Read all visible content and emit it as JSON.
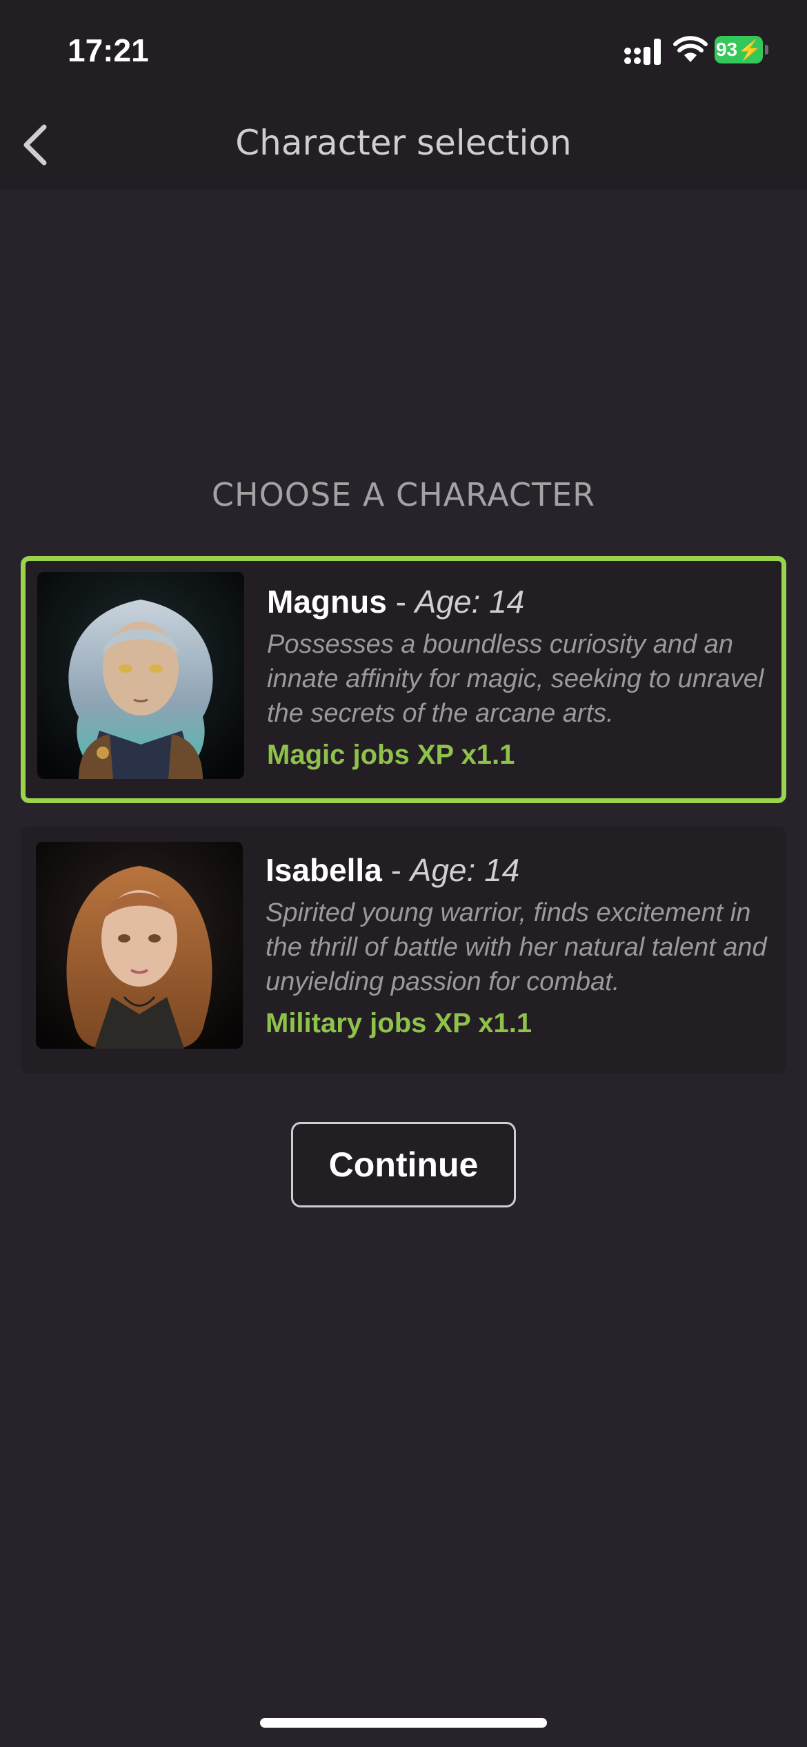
{
  "status_bar": {
    "time": "17:21",
    "battery": "93",
    "icons": [
      "signal-icon",
      "wifi-icon",
      "battery-charging-icon"
    ]
  },
  "nav": {
    "title": "Character selection",
    "back_icon": "chevron-left-icon"
  },
  "heading": "CHOOSE A CHARACTER",
  "characters": [
    {
      "name": "Magnus",
      "separator": "-",
      "age_label": "Age: 14",
      "description": "Possesses a boundless curiosity and an innate affinity for magic, seeking to unravel the secrets of the arcane arts.",
      "bonus": "Magic jobs XP x1.1",
      "selected": true
    },
    {
      "name": "Isabella",
      "separator": "-",
      "age_label": "Age: 14",
      "description": "Spirited young warrior, finds excitement in the thrill of battle with her natural talent and unyielding passion for combat.",
      "bonus": "Military jobs XP x1.1",
      "selected": false
    }
  ],
  "continue_label": "Continue",
  "colors": {
    "background": "#28232b",
    "card": "#221e24",
    "accent_green": "#9bd34f",
    "bonus_green": "#8fc24a",
    "battery_green": "#34c759"
  }
}
